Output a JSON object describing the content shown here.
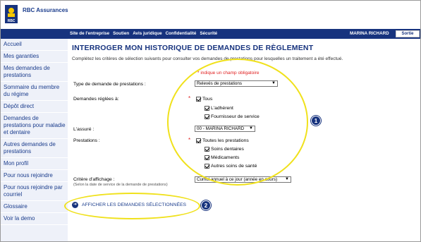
{
  "header": {
    "brand": "RBC Assurances",
    "logo_text": "RBC"
  },
  "topnav": {
    "links": [
      "Site de l'entreprise",
      "Soutien",
      "Avis juridique",
      "Confidentialité",
      "Sécurité"
    ],
    "user": "MARINA RICHARD",
    "logout": "Sortie"
  },
  "sidebar": {
    "items": [
      "Accueil",
      "Mes garanties",
      "Mes demandes de prestations",
      "Sommaire du membre du régime",
      "Dépôt direct",
      "Demandes de prestations pour maladie et dentaire",
      "Autres demandes de prestations",
      "Mon profil",
      "Pour nous rejoindre",
      "Pour nous rejoindre par courriel",
      "Glossaire",
      "Voir la demo"
    ]
  },
  "main": {
    "title": "INTERROGER MON HISTORIQUE DE DEMANDES DE RÈGLEMENT",
    "intro": "Complétez les critères de sélection suivants pour consulter vos demandes de prestations pour lesquelles un traitement a été effectué.",
    "required_note": "* indique un champ obligatoire",
    "type_label": "Type de demande de prestations :",
    "type_value": "Relevés de prestations",
    "settled_label": "Demandes réglées à:",
    "settled_options": [
      "Tous",
      "L'adhérent",
      "Fournisseur de service"
    ],
    "insured_label": "L'assuré :",
    "insured_value": "00 - MARINA RICHARD",
    "benefits_label": "Prestations :",
    "benefits_options": [
      "Toutes les prestations",
      "Soins dentaires",
      "Médicaments",
      "Autres soins de santé"
    ],
    "display_label": "Critère d'affichage :",
    "display_sublabel": "(Selon la date de service de la demande de prestations)",
    "display_value": "Cumul annuel à ce jour (année en cours)",
    "submit_label": "AFFICHER LES DEMANDES SÉLECTIONNÉES",
    "submit_icon": "arrow-right-icon"
  },
  "annotations": {
    "badge_1": "1",
    "badge_2": "2"
  },
  "colors": {
    "nav_bg": "#17337e",
    "link": "#1a3c8c",
    "highlight": "#f0e11c",
    "required": "#e02020",
    "sidebar_bg": "#eef1f9"
  }
}
